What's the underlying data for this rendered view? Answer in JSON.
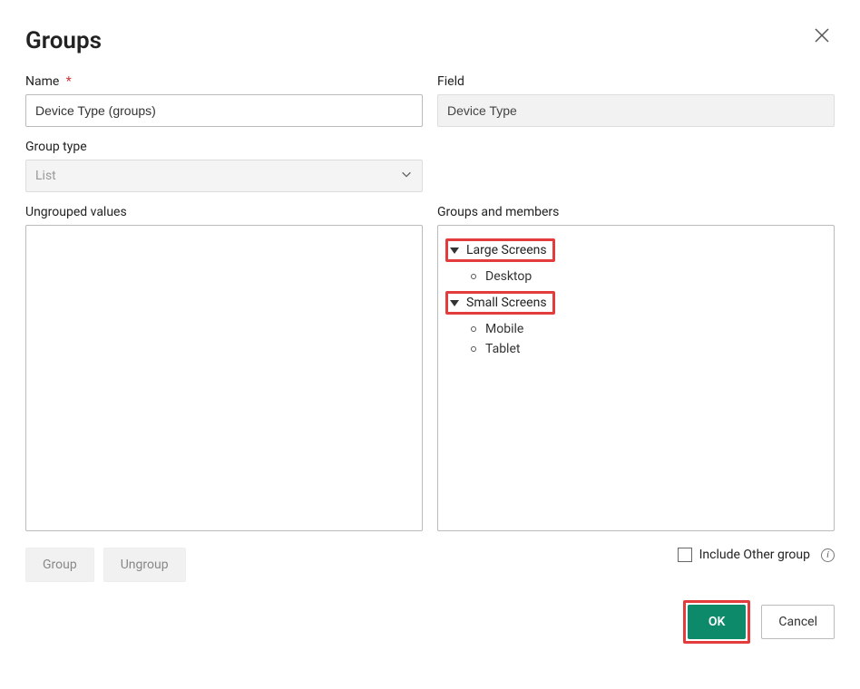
{
  "dialog": {
    "title": "Groups"
  },
  "nameField": {
    "label": "Name",
    "required": "*",
    "value": "Device Type (groups)"
  },
  "fieldField": {
    "label": "Field",
    "value": "Device Type"
  },
  "groupType": {
    "label": "Group type",
    "value": "List"
  },
  "ungrouped": {
    "label": "Ungrouped values"
  },
  "groupsMembers": {
    "label": "Groups and members",
    "groups": [
      {
        "name": "Large Screens",
        "highlight": true,
        "members": [
          "Desktop"
        ]
      },
      {
        "name": "Small Screens",
        "highlight": true,
        "members": [
          "Mobile",
          "Tablet"
        ]
      }
    ]
  },
  "actions": {
    "group": "Group",
    "ungroup": "Ungroup"
  },
  "includeOther": {
    "label": "Include Other group",
    "checked": false
  },
  "footer": {
    "ok": "OK",
    "cancel": "Cancel"
  }
}
